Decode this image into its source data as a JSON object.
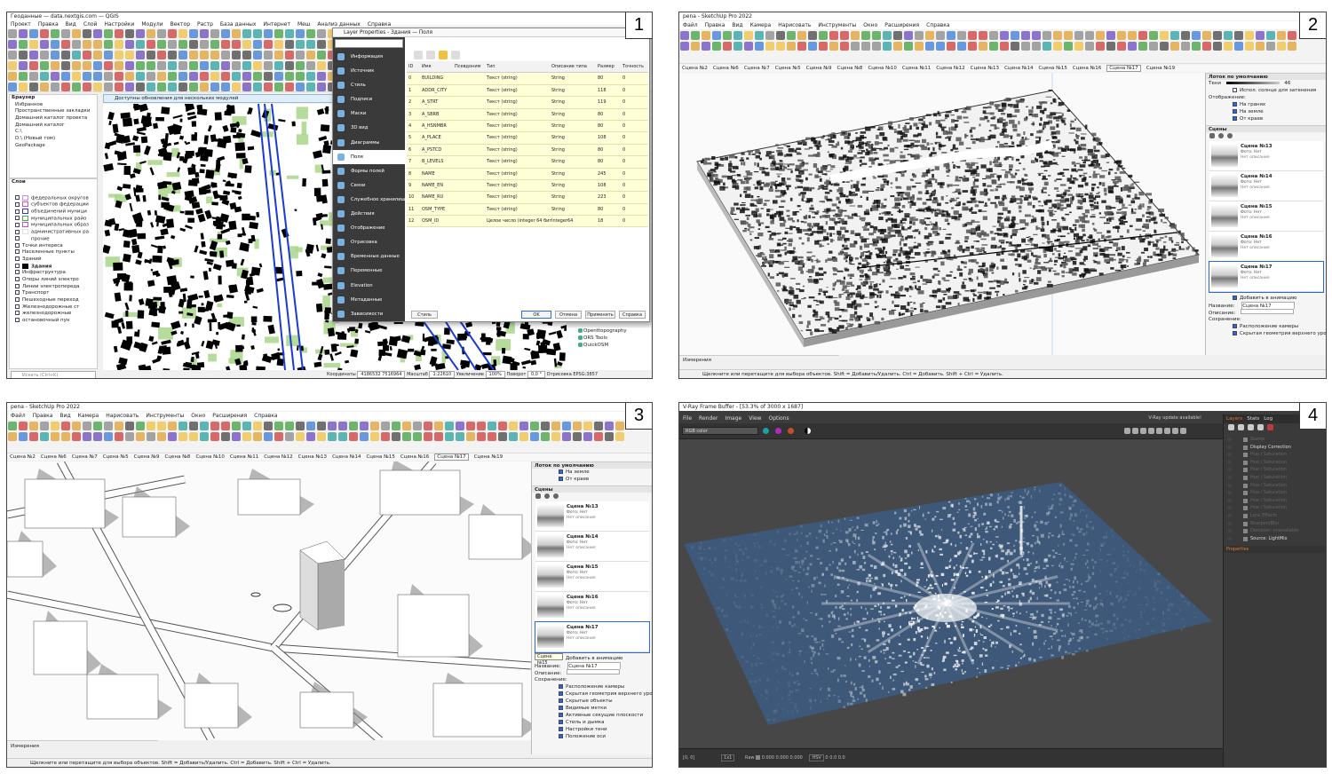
{
  "panels": {
    "p1": {
      "number": "1",
      "title": "Геоданные — data.nextgis.com — QGIS",
      "menu": [
        "Проект",
        "Правка",
        "Вид",
        "Слой",
        "Настройки",
        "Модули",
        "Вектор",
        "Растр",
        "База данных",
        "Интернет",
        "Меш",
        "Анализ данных",
        "Справка"
      ],
      "browser_title": "Браузер",
      "browser_items": [
        "Избранное",
        "Пространственные закладки",
        "Домашний каталог проекта",
        "Домашний каталог",
        "C:\\",
        "D:\\ (Новый том)",
        "GeoPackage"
      ],
      "layers_title": "Слои",
      "layers": [
        {
          "label": "федеральных округов",
          "color": "#c58ee0"
        },
        {
          "label": "субъектов федерации",
          "color": "#e04ac0"
        },
        {
          "label": "объединений муници",
          "color": "#2a3ad6"
        },
        {
          "label": "муниципальных райо",
          "color": "#40b040"
        },
        {
          "label": "муниципальных образ",
          "color": "#c050d0"
        },
        {
          "label": "административных ра",
          "color": "#e0e0e0"
        },
        {
          "label": "прочие",
          "color": "#ffffff"
        },
        {
          "label": "Точки интереса",
          "color": ""
        },
        {
          "label": "Населенные пункты",
          "color": ""
        },
        {
          "label": "Зданий",
          "color": ""
        },
        {
          "label": "Здания",
          "color": "#000000"
        },
        {
          "label": "Инфраструктура",
          "color": ""
        },
        {
          "label": "Опоры линий электро",
          "color": ""
        },
        {
          "label": "Линии электропереда",
          "color": ""
        },
        {
          "label": "Транспорт",
          "color": ""
        },
        {
          "label": "Пешеходные переход",
          "color": ""
        },
        {
          "label": "Железнодорожные ст",
          "color": ""
        },
        {
          "label": "железнодорожные",
          "color": ""
        },
        {
          "label": "остановочный пун",
          "color": ""
        }
      ],
      "notice": "Доступны обновления для нескольких модулей",
      "search_placeholder": "Искать (Ctrl+K)",
      "status": {
        "coord_label": "Координаты",
        "coord": "4186532 7516964",
        "scale_label": "Масштаб",
        "scale": "1:22610",
        "zoom_label": "Увеличение",
        "zoom": "100%",
        "rotate_label": "Поворот",
        "rotate": "0,0 °",
        "render": "Отрисовка",
        "crs": "EPSG:3857"
      },
      "plugins": [
        "Openttopography",
        "ORS Tools",
        "QuickOSM"
      ],
      "dialog": {
        "title": "Layer Properties - Здания — Поля",
        "tabs": [
          "Информация",
          "Источник",
          "Стиль",
          "Подписи",
          "Маски",
          "3D вид",
          "Диаграммы",
          "Поля",
          "Формы полей",
          "Связи",
          "Служебное хранилище",
          "Действия",
          "Отображение",
          "Отрисовка",
          "Временные данные",
          "Переменные",
          "Elevation",
          "Метаданные",
          "Зависимости"
        ],
        "selected_tab": "Поля",
        "columns": [
          "ID",
          "Имя",
          "Псевдоним",
          "Тип",
          "Описание типа",
          "Размер",
          "Точность"
        ],
        "rows": [
          [
            "0",
            "BUILDING",
            "",
            "Текст (string)",
            "String",
            "80",
            "0"
          ],
          [
            "1",
            "ADDR_CITY",
            "",
            "Текст (string)",
            "String",
            "118",
            "0"
          ],
          [
            "2",
            "A_STRT",
            "",
            "Текст (string)",
            "String",
            "119",
            "0"
          ],
          [
            "3",
            "A_SBRB",
            "",
            "Текст (string)",
            "String",
            "80",
            "0"
          ],
          [
            "4",
            "A_HSNMBR",
            "",
            "Текст (string)",
            "String",
            "80",
            "0"
          ],
          [
            "5",
            "A_PLACE",
            "",
            "Текст (string)",
            "String",
            "108",
            "0"
          ],
          [
            "6",
            "A_PSTCD",
            "",
            "Текст (string)",
            "String",
            "80",
            "0"
          ],
          [
            "7",
            "B_LEVELS",
            "",
            "Текст (string)",
            "String",
            "80",
            "0"
          ],
          [
            "8",
            "NAME",
            "",
            "Текст (string)",
            "String",
            "245",
            "0"
          ],
          [
            "9",
            "NAME_EN",
            "",
            "Текст (string)",
            "String",
            "108",
            "0"
          ],
          [
            "10",
            "NAME_RU",
            "",
            "Текст (string)",
            "String",
            "223",
            "0"
          ],
          [
            "11",
            "OSM_TYPE",
            "",
            "Текст (string)",
            "String",
            "80",
            "0"
          ],
          [
            "12",
            "OSM_ID",
            "",
            "Целое число (integer 64 бита)",
            "Integer64",
            "18",
            "0"
          ]
        ],
        "buttons": {
          "style": "Стиль",
          "ok": "OK",
          "cancel": "Отмена",
          "apply": "Применить",
          "help": "Справка"
        }
      }
    },
    "p2": {
      "number": "2",
      "title": "pena - SketchUp Pro 2022",
      "menu": [
        "Файл",
        "Правка",
        "Вид",
        "Камера",
        "Нарисовать",
        "Инструменты",
        "Окно",
        "Расширения",
        "Справка"
      ],
      "scenes": [
        "Сцена №2",
        "Сцена №6",
        "Сцена №7",
        "Сцена №5",
        "Сцена №9",
        "Сцена №8",
        "Сцена №10",
        "Сцена №11",
        "Сцена №12",
        "Сцена №13",
        "Сцена №14",
        "Сцена №15",
        "Сцена №16",
        "Сцена №17",
        "Сцена №19"
      ],
      "selected_scene": "Сцена №17",
      "tray_title": "Лоток по умолчанию",
      "shadow_label": "Тени",
      "shadow_value": "46",
      "sun_label": "Испол. солнце для затенения",
      "display_label": "Отображение:",
      "display_opts": [
        "На гранях",
        "На земле",
        "От краев"
      ],
      "scenes_header": "Сцены",
      "scene_cards": [
        {
          "name": "Сцена №13",
          "s1": "Фото: Нет",
          "s2": "Нет описания"
        },
        {
          "name": "Сцена №14",
          "s1": "Фото: Нет",
          "s2": "Нет описания"
        },
        {
          "name": "Сцена №15",
          "s1": "Фото: Нет",
          "s2": "Нет описания"
        },
        {
          "name": "Сцена №16",
          "s1": "Фото: Нет",
          "s2": "Нет описания"
        },
        {
          "name": "Сцена №17",
          "s1": "Фото: Нет",
          "s2": "Нет описания"
        }
      ],
      "add_anim": "Добавить в анимацию",
      "name_label": "Название:",
      "name_value": "Сцена №17",
      "desc_label": "Описание:",
      "save_label": "Сохранение:",
      "save_opts": [
        "Расположение камеры",
        "Скрытая геометрия верхнего уровня"
      ],
      "measure": "Измерения",
      "status": "Щелкните или перетащите для выбора объектов. Shift = Добавить/Удалить. Ctrl = Добавить. Shift + Ctrl = Удалить."
    },
    "p3": {
      "number": "3",
      "title": "pena - SketchUp Pro 2022",
      "menu": [
        "Файл",
        "Правка",
        "Вид",
        "Камера",
        "Нарисовать",
        "Инструменты",
        "Окно",
        "Расширения",
        "Справка"
      ],
      "scenes": [
        "Сцена №2",
        "Сцена №6",
        "Сцена №7",
        "Сцена №5",
        "Сцена №9",
        "Сцена №8",
        "Сцена №10",
        "Сцена №11",
        "Сцена №12",
        "Сцена №13",
        "Сцена №14",
        "Сцена №15",
        "Сцена №16",
        "Сцена №17",
        "Сцена №19"
      ],
      "selected_scene": "Сцена №17",
      "tray_title": "Лоток по умолчанию",
      "display_opts": [
        "На земле",
        "От краев"
      ],
      "scenes_header": "Сцены",
      "scene_cards": [
        {
          "name": "Сцена №13",
          "s1": "Фото: Нет",
          "s2": "Нет описания"
        },
        {
          "name": "Сцена №14",
          "s1": "Фото: Нет",
          "s2": "Нет описания"
        },
        {
          "name": "Сцена №15",
          "s1": "Фото: Нет",
          "s2": "Нет описания"
        },
        {
          "name": "Сцена №16",
          "s1": "Фото: Нет",
          "s2": "Нет описания"
        },
        {
          "name": "Сцена №17",
          "s1": "Фото: Нет",
          "s2": "Нет описания"
        }
      ],
      "tooltip": "Сцена №15",
      "add_anim": "Добавить в анимацию",
      "name_label": "Название:",
      "name_value": "Сцена №17",
      "desc_label": "Описание:",
      "save_label": "Сохранение:",
      "save_opts": [
        "Расположение камеры",
        "Скрытая геометрия верхнего уровня",
        "Скрытые объекты",
        "Видимые метки",
        "Активные секущие плоскости",
        "Стиль и дымка",
        "Настройки тени",
        "Положение оси"
      ],
      "measure": "Измерения",
      "status": "Щелкните или перетащите для выбора объектов. Shift = Добавить/Удалить. Ctrl = Добавить. Shift + Ctrl = Удалить."
    },
    "p4": {
      "number": "4",
      "title": "V-Ray Frame Buffer - [53.3% of 3000 x 1687]",
      "menu": [
        "File",
        "Render",
        "Image",
        "View",
        "Options"
      ],
      "update": "V-Ray update available!",
      "channel": "RGB color",
      "tabs": [
        "Layers",
        "Stats",
        "Log"
      ],
      "layers": [
        "Stamp",
        "Display Correction",
        "Hue / Saturation",
        "Hue / Saturation",
        "Hue / Saturation",
        "Hue / Saturation",
        "Hue / Saturation",
        "Hue / Saturation",
        "Hue / Saturation",
        "Hue / Saturation",
        "Lens Effects",
        "Sharpen/Blur",
        "Denoiser: unavailable",
        "Source: LightMix"
      ],
      "properties": "Properties",
      "status": {
        "coords": "[0, 0]",
        "mode": "1x1",
        "raw": "Raw",
        "r": "0.000",
        "g": "0.000",
        "b": "0.000",
        "hsv": "HSV",
        "h": "0",
        "s": "0.0",
        "v": "0.0"
      }
    }
  }
}
